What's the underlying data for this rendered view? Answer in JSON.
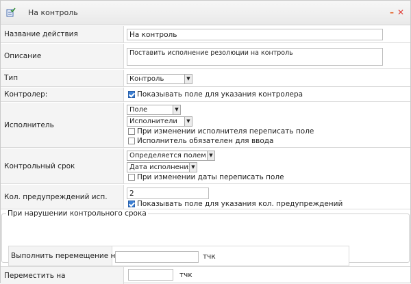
{
  "window": {
    "title": "На контроль"
  },
  "fields": {
    "action_name": {
      "label": "Название действия",
      "value": "На контроль"
    },
    "description": {
      "label": "Описание",
      "value": "Поставить исполнение резолюции на контроль"
    },
    "type": {
      "label": "Тип",
      "selected": "Контроль"
    },
    "controller": {
      "label": "Контролер:",
      "checkbox_label": "Показывать поле для указания контролера",
      "checked": true
    },
    "executor": {
      "label": "Исполнитель",
      "select1": "Поле",
      "select2": "Исполнители",
      "check1_label": "При изменении исполнителя переписать поле",
      "check1_checked": false,
      "check2_label": "Исполнитель обязателен для ввода",
      "check2_checked": false
    },
    "deadline": {
      "label": "Контрольный срок",
      "select1": "Определяется полем",
      "select2": "Дата исполнения",
      "check_label": "При изменении даты переписать поле",
      "check_checked": false
    },
    "warnings": {
      "label": "Кол. предупреждений исп.",
      "value": "2",
      "checkbox_label": "Показывать поле для указания кол. предупреждений",
      "checked": true
    }
  },
  "violation": {
    "legend": "При нарушении контрольного срока",
    "label": "Выполнить перемещение на",
    "value": "",
    "unit": "тчк"
  },
  "move": {
    "label": "Переместить на",
    "value": "",
    "unit": "тчк"
  }
}
